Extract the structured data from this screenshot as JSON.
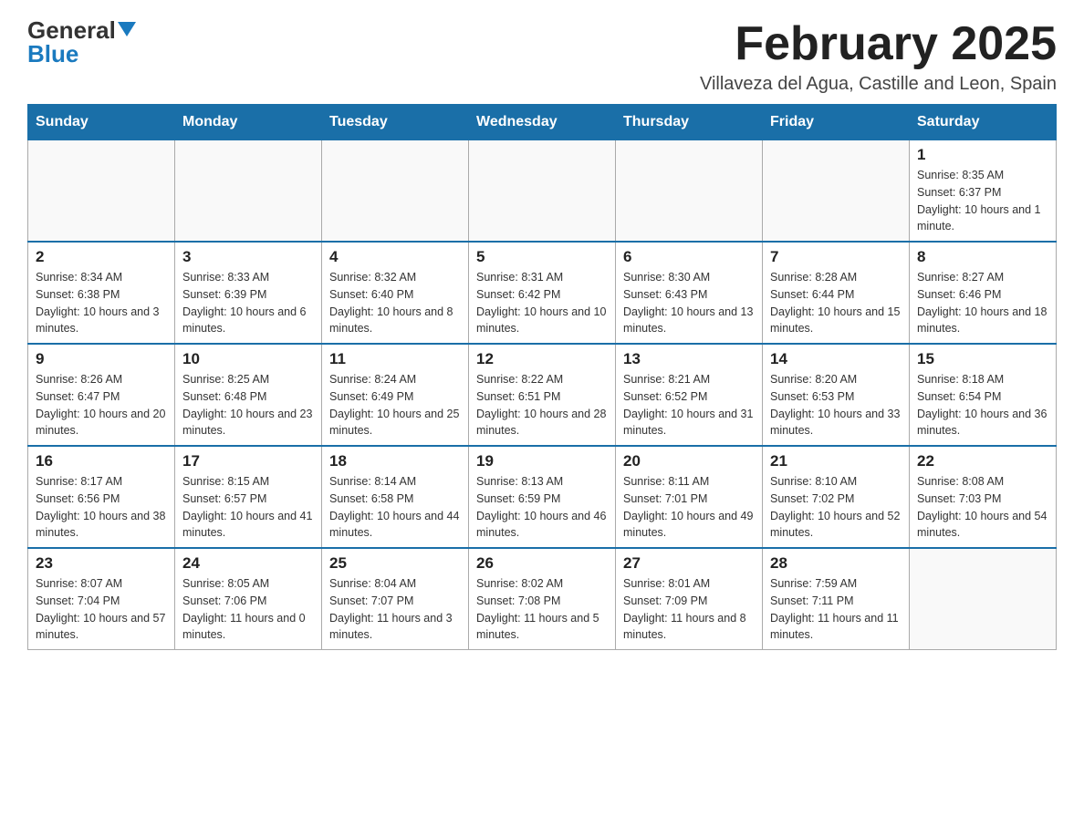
{
  "header": {
    "logo": {
      "general": "General",
      "blue": "Blue"
    },
    "month_title": "February 2025",
    "location": "Villaveza del Agua, Castille and Leon, Spain"
  },
  "calendar": {
    "days_of_week": [
      "Sunday",
      "Monday",
      "Tuesday",
      "Wednesday",
      "Thursday",
      "Friday",
      "Saturday"
    ],
    "weeks": [
      [
        {
          "day": "",
          "info": ""
        },
        {
          "day": "",
          "info": ""
        },
        {
          "day": "",
          "info": ""
        },
        {
          "day": "",
          "info": ""
        },
        {
          "day": "",
          "info": ""
        },
        {
          "day": "",
          "info": ""
        },
        {
          "day": "1",
          "info": "Sunrise: 8:35 AM\nSunset: 6:37 PM\nDaylight: 10 hours and 1 minute."
        }
      ],
      [
        {
          "day": "2",
          "info": "Sunrise: 8:34 AM\nSunset: 6:38 PM\nDaylight: 10 hours and 3 minutes."
        },
        {
          "day": "3",
          "info": "Sunrise: 8:33 AM\nSunset: 6:39 PM\nDaylight: 10 hours and 6 minutes."
        },
        {
          "day": "4",
          "info": "Sunrise: 8:32 AM\nSunset: 6:40 PM\nDaylight: 10 hours and 8 minutes."
        },
        {
          "day": "5",
          "info": "Sunrise: 8:31 AM\nSunset: 6:42 PM\nDaylight: 10 hours and 10 minutes."
        },
        {
          "day": "6",
          "info": "Sunrise: 8:30 AM\nSunset: 6:43 PM\nDaylight: 10 hours and 13 minutes."
        },
        {
          "day": "7",
          "info": "Sunrise: 8:28 AM\nSunset: 6:44 PM\nDaylight: 10 hours and 15 minutes."
        },
        {
          "day": "8",
          "info": "Sunrise: 8:27 AM\nSunset: 6:46 PM\nDaylight: 10 hours and 18 minutes."
        }
      ],
      [
        {
          "day": "9",
          "info": "Sunrise: 8:26 AM\nSunset: 6:47 PM\nDaylight: 10 hours and 20 minutes."
        },
        {
          "day": "10",
          "info": "Sunrise: 8:25 AM\nSunset: 6:48 PM\nDaylight: 10 hours and 23 minutes."
        },
        {
          "day": "11",
          "info": "Sunrise: 8:24 AM\nSunset: 6:49 PM\nDaylight: 10 hours and 25 minutes."
        },
        {
          "day": "12",
          "info": "Sunrise: 8:22 AM\nSunset: 6:51 PM\nDaylight: 10 hours and 28 minutes."
        },
        {
          "day": "13",
          "info": "Sunrise: 8:21 AM\nSunset: 6:52 PM\nDaylight: 10 hours and 31 minutes."
        },
        {
          "day": "14",
          "info": "Sunrise: 8:20 AM\nSunset: 6:53 PM\nDaylight: 10 hours and 33 minutes."
        },
        {
          "day": "15",
          "info": "Sunrise: 8:18 AM\nSunset: 6:54 PM\nDaylight: 10 hours and 36 minutes."
        }
      ],
      [
        {
          "day": "16",
          "info": "Sunrise: 8:17 AM\nSunset: 6:56 PM\nDaylight: 10 hours and 38 minutes."
        },
        {
          "day": "17",
          "info": "Sunrise: 8:15 AM\nSunset: 6:57 PM\nDaylight: 10 hours and 41 minutes."
        },
        {
          "day": "18",
          "info": "Sunrise: 8:14 AM\nSunset: 6:58 PM\nDaylight: 10 hours and 44 minutes."
        },
        {
          "day": "19",
          "info": "Sunrise: 8:13 AM\nSunset: 6:59 PM\nDaylight: 10 hours and 46 minutes."
        },
        {
          "day": "20",
          "info": "Sunrise: 8:11 AM\nSunset: 7:01 PM\nDaylight: 10 hours and 49 minutes."
        },
        {
          "day": "21",
          "info": "Sunrise: 8:10 AM\nSunset: 7:02 PM\nDaylight: 10 hours and 52 minutes."
        },
        {
          "day": "22",
          "info": "Sunrise: 8:08 AM\nSunset: 7:03 PM\nDaylight: 10 hours and 54 minutes."
        }
      ],
      [
        {
          "day": "23",
          "info": "Sunrise: 8:07 AM\nSunset: 7:04 PM\nDaylight: 10 hours and 57 minutes."
        },
        {
          "day": "24",
          "info": "Sunrise: 8:05 AM\nSunset: 7:06 PM\nDaylight: 11 hours and 0 minutes."
        },
        {
          "day": "25",
          "info": "Sunrise: 8:04 AM\nSunset: 7:07 PM\nDaylight: 11 hours and 3 minutes."
        },
        {
          "day": "26",
          "info": "Sunrise: 8:02 AM\nSunset: 7:08 PM\nDaylight: 11 hours and 5 minutes."
        },
        {
          "day": "27",
          "info": "Sunrise: 8:01 AM\nSunset: 7:09 PM\nDaylight: 11 hours and 8 minutes."
        },
        {
          "day": "28",
          "info": "Sunrise: 7:59 AM\nSunset: 7:11 PM\nDaylight: 11 hours and 11 minutes."
        },
        {
          "day": "",
          "info": ""
        }
      ]
    ]
  }
}
